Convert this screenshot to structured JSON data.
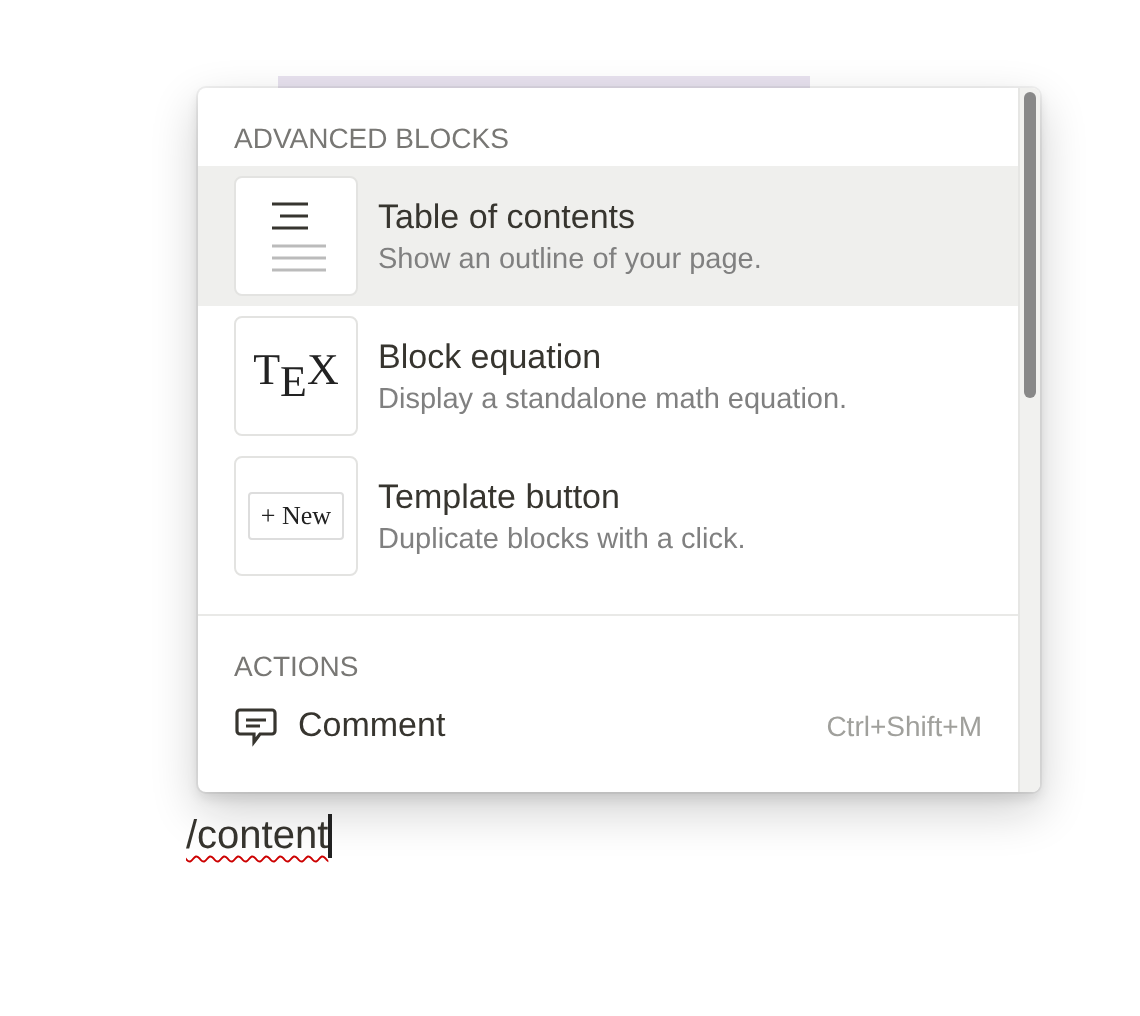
{
  "menu": {
    "sections": [
      {
        "heading": "ADVANCED BLOCKS",
        "items": [
          {
            "kind": "outline",
            "title": "Table of contents",
            "description": "Show an outline of your page.",
            "selected": true
          },
          {
            "kind": "tex",
            "thumb_text": "T$_{E}$X",
            "title": "Block equation",
            "description": "Display a standalone math equation.",
            "selected": false
          },
          {
            "kind": "new",
            "thumb_text": "+ New",
            "title": "Template button",
            "description": "Duplicate blocks with a click.",
            "selected": false
          }
        ]
      },
      {
        "heading": "ACTIONS",
        "items": [
          {
            "kind": "comment",
            "title": "Comment",
            "shortcut": "Ctrl+Shift+M",
            "selected": false
          }
        ]
      }
    ]
  },
  "editor": {
    "text": "/content",
    "misspelled": true
  }
}
